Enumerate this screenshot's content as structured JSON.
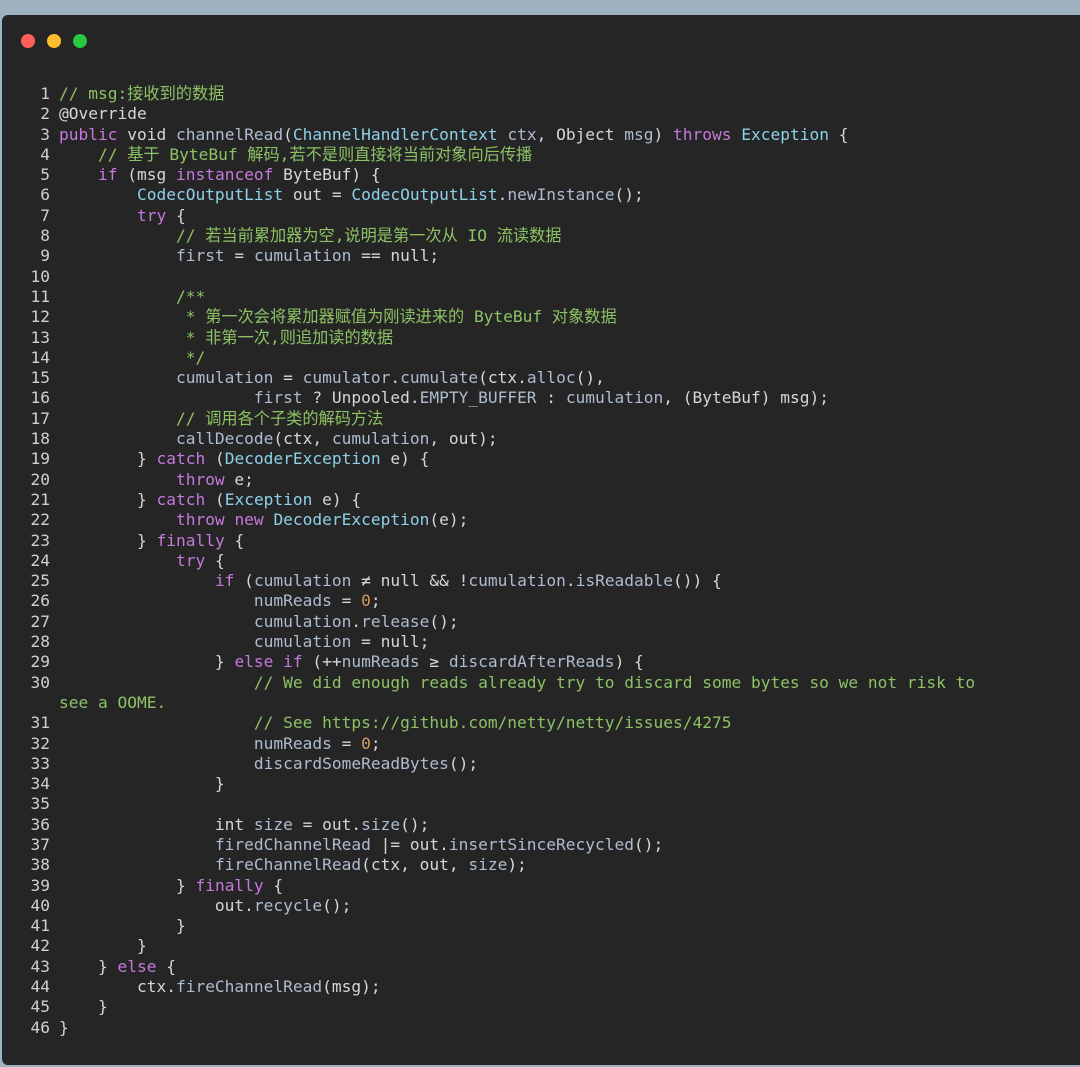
{
  "window": {
    "controls": [
      {
        "name": "close",
        "color": "#ff5f56"
      },
      {
        "name": "minimize",
        "color": "#ffbd2e"
      },
      {
        "name": "zoom",
        "color": "#27c93f"
      }
    ]
  },
  "code": {
    "lines": [
      {
        "n": "1",
        "tokens": [
          [
            "c",
            "// msg:接收到的数据"
          ]
        ]
      },
      {
        "n": "2",
        "tokens": [
          [
            "p",
            "@Override"
          ]
        ]
      },
      {
        "n": "3",
        "tokens": [
          [
            "k",
            "public"
          ],
          [
            "p",
            " void "
          ],
          [
            "f",
            "channelRead"
          ],
          [
            "p",
            "("
          ],
          [
            "t",
            "ChannelHandlerContext"
          ],
          [
            "v",
            " ctx"
          ],
          [
            "p",
            ", Object "
          ],
          [
            "v",
            "msg"
          ],
          [
            "p",
            ") "
          ],
          [
            "k",
            "throws"
          ],
          [
            "p",
            " "
          ],
          [
            "t",
            "Exception"
          ],
          [
            "p",
            " {"
          ]
        ]
      },
      {
        "n": "4",
        "tokens": [
          [
            "p",
            "    "
          ],
          [
            "c",
            "// 基于 ByteBuf 解码,若不是则直接将当前对象向后传播"
          ]
        ]
      },
      {
        "n": "5",
        "tokens": [
          [
            "p",
            "    "
          ],
          [
            "k",
            "if"
          ],
          [
            "p",
            " (msg "
          ],
          [
            "k",
            "instanceof"
          ],
          [
            "p",
            " ByteBuf) {"
          ]
        ]
      },
      {
        "n": "6",
        "tokens": [
          [
            "p",
            "        "
          ],
          [
            "t",
            "CodecOutputList"
          ],
          [
            "p",
            " out = "
          ],
          [
            "t",
            "CodecOutputList"
          ],
          [
            "p",
            "."
          ],
          [
            "v",
            "newInstance"
          ],
          [
            "p",
            "();"
          ]
        ]
      },
      {
        "n": "7",
        "tokens": [
          [
            "p",
            "        "
          ],
          [
            "k",
            "try"
          ],
          [
            "p",
            " {"
          ]
        ]
      },
      {
        "n": "8",
        "tokens": [
          [
            "p",
            "            "
          ],
          [
            "c",
            "// 若当前累加器为空,说明是第一次从 IO 流读数据"
          ]
        ]
      },
      {
        "n": "9",
        "tokens": [
          [
            "p",
            "            "
          ],
          [
            "v",
            "first"
          ],
          [
            "p",
            " = "
          ],
          [
            "v",
            "cumulation"
          ],
          [
            "p",
            " == null;"
          ]
        ]
      },
      {
        "n": "10",
        "tokens": []
      },
      {
        "n": "11",
        "tokens": [
          [
            "p",
            "            "
          ],
          [
            "c",
            "/**"
          ]
        ]
      },
      {
        "n": "12",
        "tokens": [
          [
            "p",
            "             "
          ],
          [
            "c",
            "* 第一次会将累加器赋值为刚读进来的 ByteBuf 对象数据"
          ]
        ]
      },
      {
        "n": "13",
        "tokens": [
          [
            "p",
            "             "
          ],
          [
            "c",
            "* 非第一次,则追加读的数据"
          ]
        ]
      },
      {
        "n": "14",
        "tokens": [
          [
            "p",
            "             "
          ],
          [
            "c",
            "*/"
          ]
        ]
      },
      {
        "n": "15",
        "tokens": [
          [
            "p",
            "            "
          ],
          [
            "v",
            "cumulation"
          ],
          [
            "p",
            " = "
          ],
          [
            "v",
            "cumulator"
          ],
          [
            "p",
            "."
          ],
          [
            "v",
            "cumulate"
          ],
          [
            "p",
            "(ctx."
          ],
          [
            "v",
            "alloc"
          ],
          [
            "p",
            "(),"
          ]
        ]
      },
      {
        "n": "16",
        "tokens": [
          [
            "p",
            "                    "
          ],
          [
            "v",
            "first"
          ],
          [
            "p",
            " ? Unpooled."
          ],
          [
            "v",
            "EMPTY_BUFFER"
          ],
          [
            "p",
            " : "
          ],
          [
            "v",
            "cumulation"
          ],
          [
            "p",
            ", (ByteBuf) msg);"
          ]
        ]
      },
      {
        "n": "17",
        "tokens": [
          [
            "p",
            "            "
          ],
          [
            "c",
            "// 调用各个子类的解码方法"
          ]
        ]
      },
      {
        "n": "18",
        "tokens": [
          [
            "p",
            "            "
          ],
          [
            "v",
            "callDecode"
          ],
          [
            "p",
            "(ctx, "
          ],
          [
            "v",
            "cumulation"
          ],
          [
            "p",
            ", out);"
          ]
        ]
      },
      {
        "n": "19",
        "tokens": [
          [
            "p",
            "        } "
          ],
          [
            "k",
            "catch"
          ],
          [
            "p",
            " ("
          ],
          [
            "t",
            "DecoderException"
          ],
          [
            "p",
            " e) {"
          ]
        ]
      },
      {
        "n": "20",
        "tokens": [
          [
            "p",
            "            "
          ],
          [
            "k",
            "throw"
          ],
          [
            "p",
            " e;"
          ]
        ]
      },
      {
        "n": "21",
        "tokens": [
          [
            "p",
            "        } "
          ],
          [
            "k",
            "catch"
          ],
          [
            "p",
            " ("
          ],
          [
            "t",
            "Exception"
          ],
          [
            "p",
            " e) {"
          ]
        ]
      },
      {
        "n": "22",
        "tokens": [
          [
            "p",
            "            "
          ],
          [
            "k",
            "throw"
          ],
          [
            "p",
            " "
          ],
          [
            "k",
            "new"
          ],
          [
            "p",
            " "
          ],
          [
            "t",
            "DecoderException"
          ],
          [
            "p",
            "(e);"
          ]
        ]
      },
      {
        "n": "23",
        "tokens": [
          [
            "p",
            "        } "
          ],
          [
            "k",
            "finally"
          ],
          [
            "p",
            " {"
          ]
        ]
      },
      {
        "n": "24",
        "tokens": [
          [
            "p",
            "            "
          ],
          [
            "k",
            "try"
          ],
          [
            "p",
            " {"
          ]
        ]
      },
      {
        "n": "25",
        "tokens": [
          [
            "p",
            "                "
          ],
          [
            "k",
            "if"
          ],
          [
            "p",
            " ("
          ],
          [
            "v",
            "cumulation"
          ],
          [
            "p",
            " ≠ null && !"
          ],
          [
            "v",
            "cumulation"
          ],
          [
            "p",
            "."
          ],
          [
            "v",
            "isReadable"
          ],
          [
            "p",
            "()) {"
          ]
        ]
      },
      {
        "n": "26",
        "tokens": [
          [
            "p",
            "                    "
          ],
          [
            "v",
            "numReads"
          ],
          [
            "p",
            " = "
          ],
          [
            "n",
            "0"
          ],
          [
            "p",
            ";"
          ]
        ]
      },
      {
        "n": "27",
        "tokens": [
          [
            "p",
            "                    "
          ],
          [
            "v",
            "cumulation"
          ],
          [
            "p",
            "."
          ],
          [
            "v",
            "release"
          ],
          [
            "p",
            "();"
          ]
        ]
      },
      {
        "n": "28",
        "tokens": [
          [
            "p",
            "                    "
          ],
          [
            "v",
            "cumulation"
          ],
          [
            "p",
            " = null;"
          ]
        ]
      },
      {
        "n": "29",
        "tokens": [
          [
            "p",
            "                } "
          ],
          [
            "k",
            "else if"
          ],
          [
            "p",
            " (++"
          ],
          [
            "v",
            "numReads"
          ],
          [
            "p",
            " ≥ "
          ],
          [
            "v",
            "discardAfterReads"
          ],
          [
            "p",
            ") {"
          ]
        ]
      },
      {
        "n": "30",
        "tokens": [
          [
            "p",
            "                    "
          ],
          [
            "c",
            "// We did enough reads already try to discard some bytes so we not risk to"
          ]
        ]
      },
      {
        "n": "",
        "tokens": [
          [
            "c",
            "see a OOME."
          ]
        ]
      },
      {
        "n": "31",
        "tokens": [
          [
            "p",
            "                    "
          ],
          [
            "c",
            "// See https://github.com/netty/netty/issues/4275"
          ]
        ]
      },
      {
        "n": "32",
        "tokens": [
          [
            "p",
            "                    "
          ],
          [
            "v",
            "numReads"
          ],
          [
            "p",
            " = "
          ],
          [
            "n",
            "0"
          ],
          [
            "p",
            ";"
          ]
        ]
      },
      {
        "n": "33",
        "tokens": [
          [
            "p",
            "                    "
          ],
          [
            "v",
            "discardSomeReadBytes"
          ],
          [
            "p",
            "();"
          ]
        ]
      },
      {
        "n": "34",
        "tokens": [
          [
            "p",
            "                }"
          ]
        ]
      },
      {
        "n": "35",
        "tokens": []
      },
      {
        "n": "36",
        "tokens": [
          [
            "p",
            "                int "
          ],
          [
            "v",
            "size"
          ],
          [
            "p",
            " = out."
          ],
          [
            "v",
            "size"
          ],
          [
            "p",
            "();"
          ]
        ]
      },
      {
        "n": "37",
        "tokens": [
          [
            "p",
            "                "
          ],
          [
            "v",
            "firedChannelRead"
          ],
          [
            "p",
            " |= out."
          ],
          [
            "v",
            "insertSinceRecycled"
          ],
          [
            "p",
            "();"
          ]
        ]
      },
      {
        "n": "38",
        "tokens": [
          [
            "p",
            "                "
          ],
          [
            "v",
            "fireChannelRead"
          ],
          [
            "p",
            "(ctx, out, "
          ],
          [
            "v",
            "size"
          ],
          [
            "p",
            ");"
          ]
        ]
      },
      {
        "n": "39",
        "tokens": [
          [
            "p",
            "            } "
          ],
          [
            "k",
            "finally"
          ],
          [
            "p",
            " {"
          ]
        ]
      },
      {
        "n": "40",
        "tokens": [
          [
            "p",
            "                out."
          ],
          [
            "v",
            "recycle"
          ],
          [
            "p",
            "();"
          ]
        ]
      },
      {
        "n": "41",
        "tokens": [
          [
            "p",
            "            }"
          ]
        ]
      },
      {
        "n": "42",
        "tokens": [
          [
            "p",
            "        }"
          ]
        ]
      },
      {
        "n": "43",
        "tokens": [
          [
            "p",
            "    } "
          ],
          [
            "k",
            "else"
          ],
          [
            "p",
            " {"
          ]
        ]
      },
      {
        "n": "44",
        "tokens": [
          [
            "p",
            "        ctx."
          ],
          [
            "v",
            "fireChannelRead"
          ],
          [
            "p",
            "(msg);"
          ]
        ]
      },
      {
        "n": "45",
        "tokens": [
          [
            "p",
            "    }"
          ]
        ]
      },
      {
        "n": "46",
        "tokens": [
          [
            "p",
            "}"
          ]
        ]
      }
    ]
  }
}
